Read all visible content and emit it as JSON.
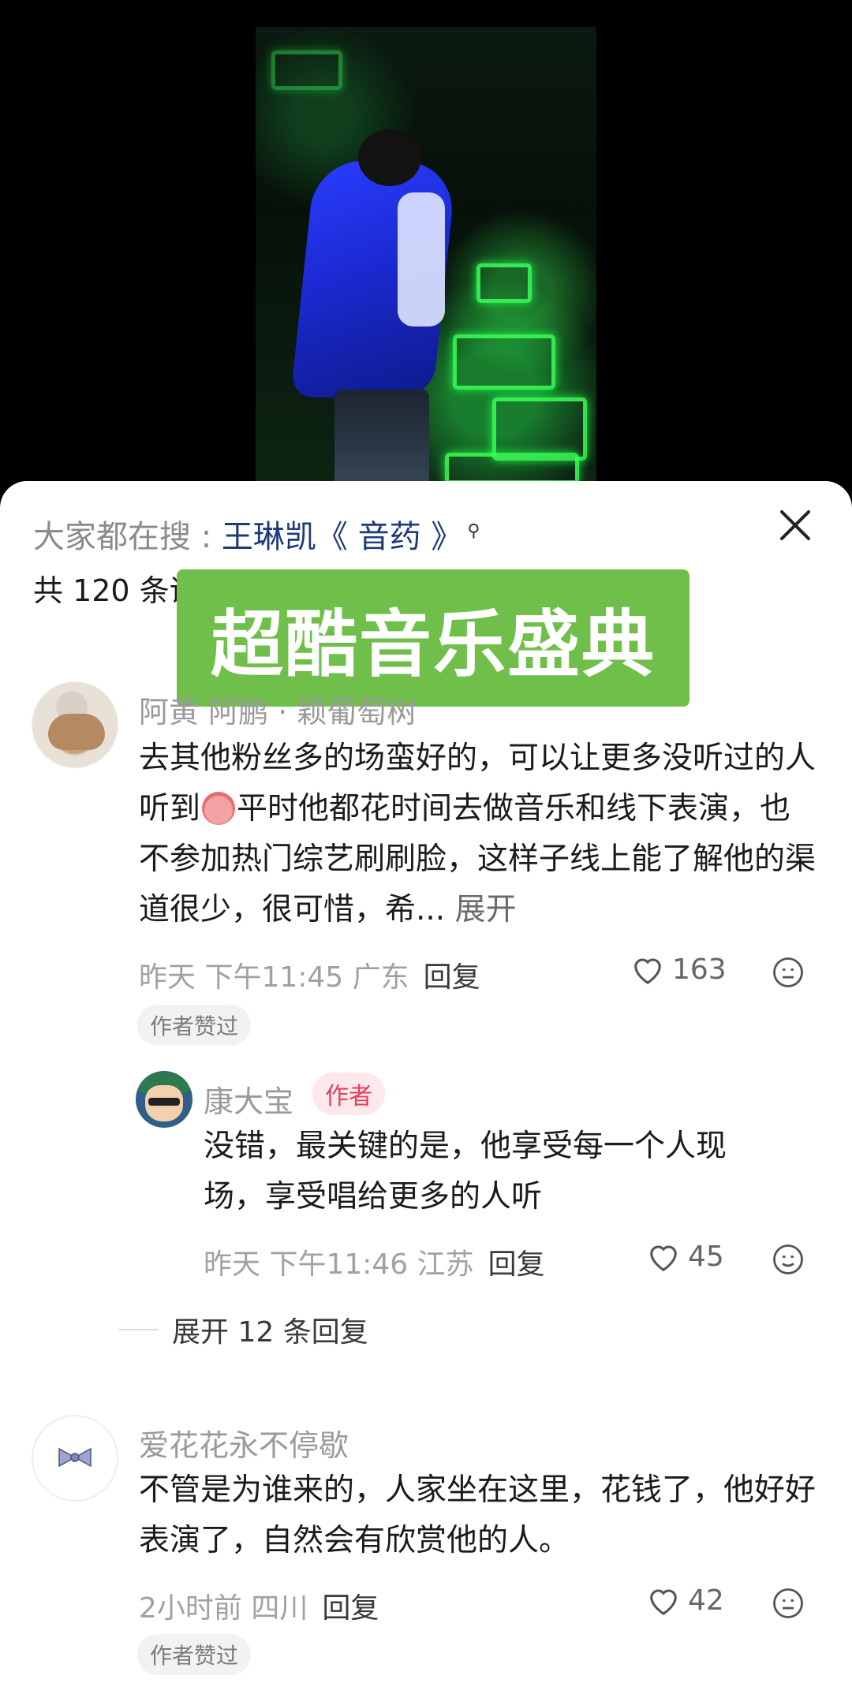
{
  "search": {
    "prefix": "大家都在搜 : ",
    "keyword": "王琳凯《 音药 》"
  },
  "comments_count": "共 120 条评论",
  "overlay_banner": "超酷音乐盛典",
  "comments": [
    {
      "author": "阿黄 阿鹏 · 颖葡萄树",
      "text_part1": "去其他粉丝多的场蛮好的，可以让更多没听过的人听到",
      "text_part2": "平时他都花时间去做音乐和线下表演，也不参加热门综艺刷刷脸，这样子线上能了解他的渠道很少，很可惜，希...",
      "expand": "展开",
      "time_loc": "昨天 下午11:45 广东",
      "reply": "回复",
      "likes": "163",
      "tag": "作者赞过"
    },
    {
      "author": "康大宝",
      "badge": "作者",
      "text": "没错，最关键的是，他享受每一个人现场，享受唱给更多的人听",
      "time_loc": "昨天 下午11:46 江苏",
      "reply": "回复",
      "likes": "45"
    },
    {
      "author": "爱花花永不停歇",
      "text": "不管是为谁来的，人家坐在这里，花钱了，他好好表演了，自然会有欣赏他的人。",
      "time_loc": "2小时前 四川",
      "reply": "回复",
      "likes": "42",
      "tag": "作者赞过"
    }
  ],
  "more_replies": "展开 12 条回复",
  "icons": [
    "close-icon",
    "search-icon",
    "heart-icon",
    "emoji-face-icon"
  ],
  "colors": {
    "banner": "#6fbf4a",
    "author_badge_text": "#e0405a",
    "keyword": "#1d3a7a"
  }
}
